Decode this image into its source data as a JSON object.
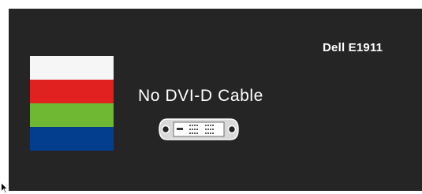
{
  "osd": {
    "model": "Dell E1911",
    "message": "No DVI-D Cable",
    "background_color": "#252525",
    "color_bars": [
      {
        "name": "white",
        "color": "#f6f6f6"
      },
      {
        "name": "red",
        "color": "#e0211f"
      },
      {
        "name": "green",
        "color": "#6fb834"
      },
      {
        "name": "blue",
        "color": "#033e8e"
      }
    ],
    "icon": "dvi-connector-icon"
  },
  "pointer": {
    "icon": "mouse-cursor-icon"
  }
}
